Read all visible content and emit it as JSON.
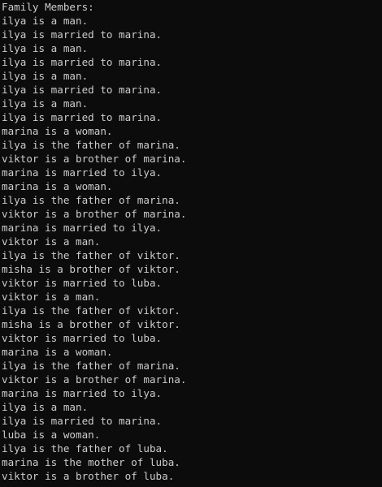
{
  "header": "Family Members:",
  "lines": [
    "ilya is a man.",
    "ilya is married to marina.",
    "ilya is a man.",
    "ilya is married to marina.",
    "ilya is a man.",
    "ilya is married to marina.",
    "ilya is a man.",
    "ilya is married to marina.",
    "marina is a woman.",
    "ilya is the father of marina.",
    "viktor is a brother of marina.",
    "marina is married to ilya.",
    "marina is a woman.",
    "ilya is the father of marina.",
    "viktor is a brother of marina.",
    "marina is married to ilya.",
    "viktor is a man.",
    "ilya is the father of viktor.",
    "misha is a brother of viktor.",
    "viktor is married to luba.",
    "viktor is a man.",
    "ilya is the father of viktor.",
    "misha is a brother of viktor.",
    "viktor is married to luba.",
    "marina is a woman.",
    "ilya is the father of marina.",
    "viktor is a brother of marina.",
    "marina is married to ilya.",
    "ilya is a man.",
    "ilya is married to marina.",
    "luba is a woman.",
    "ilya is the father of luba.",
    "marina is the mother of luba.",
    "viktor is a brother of luba."
  ]
}
